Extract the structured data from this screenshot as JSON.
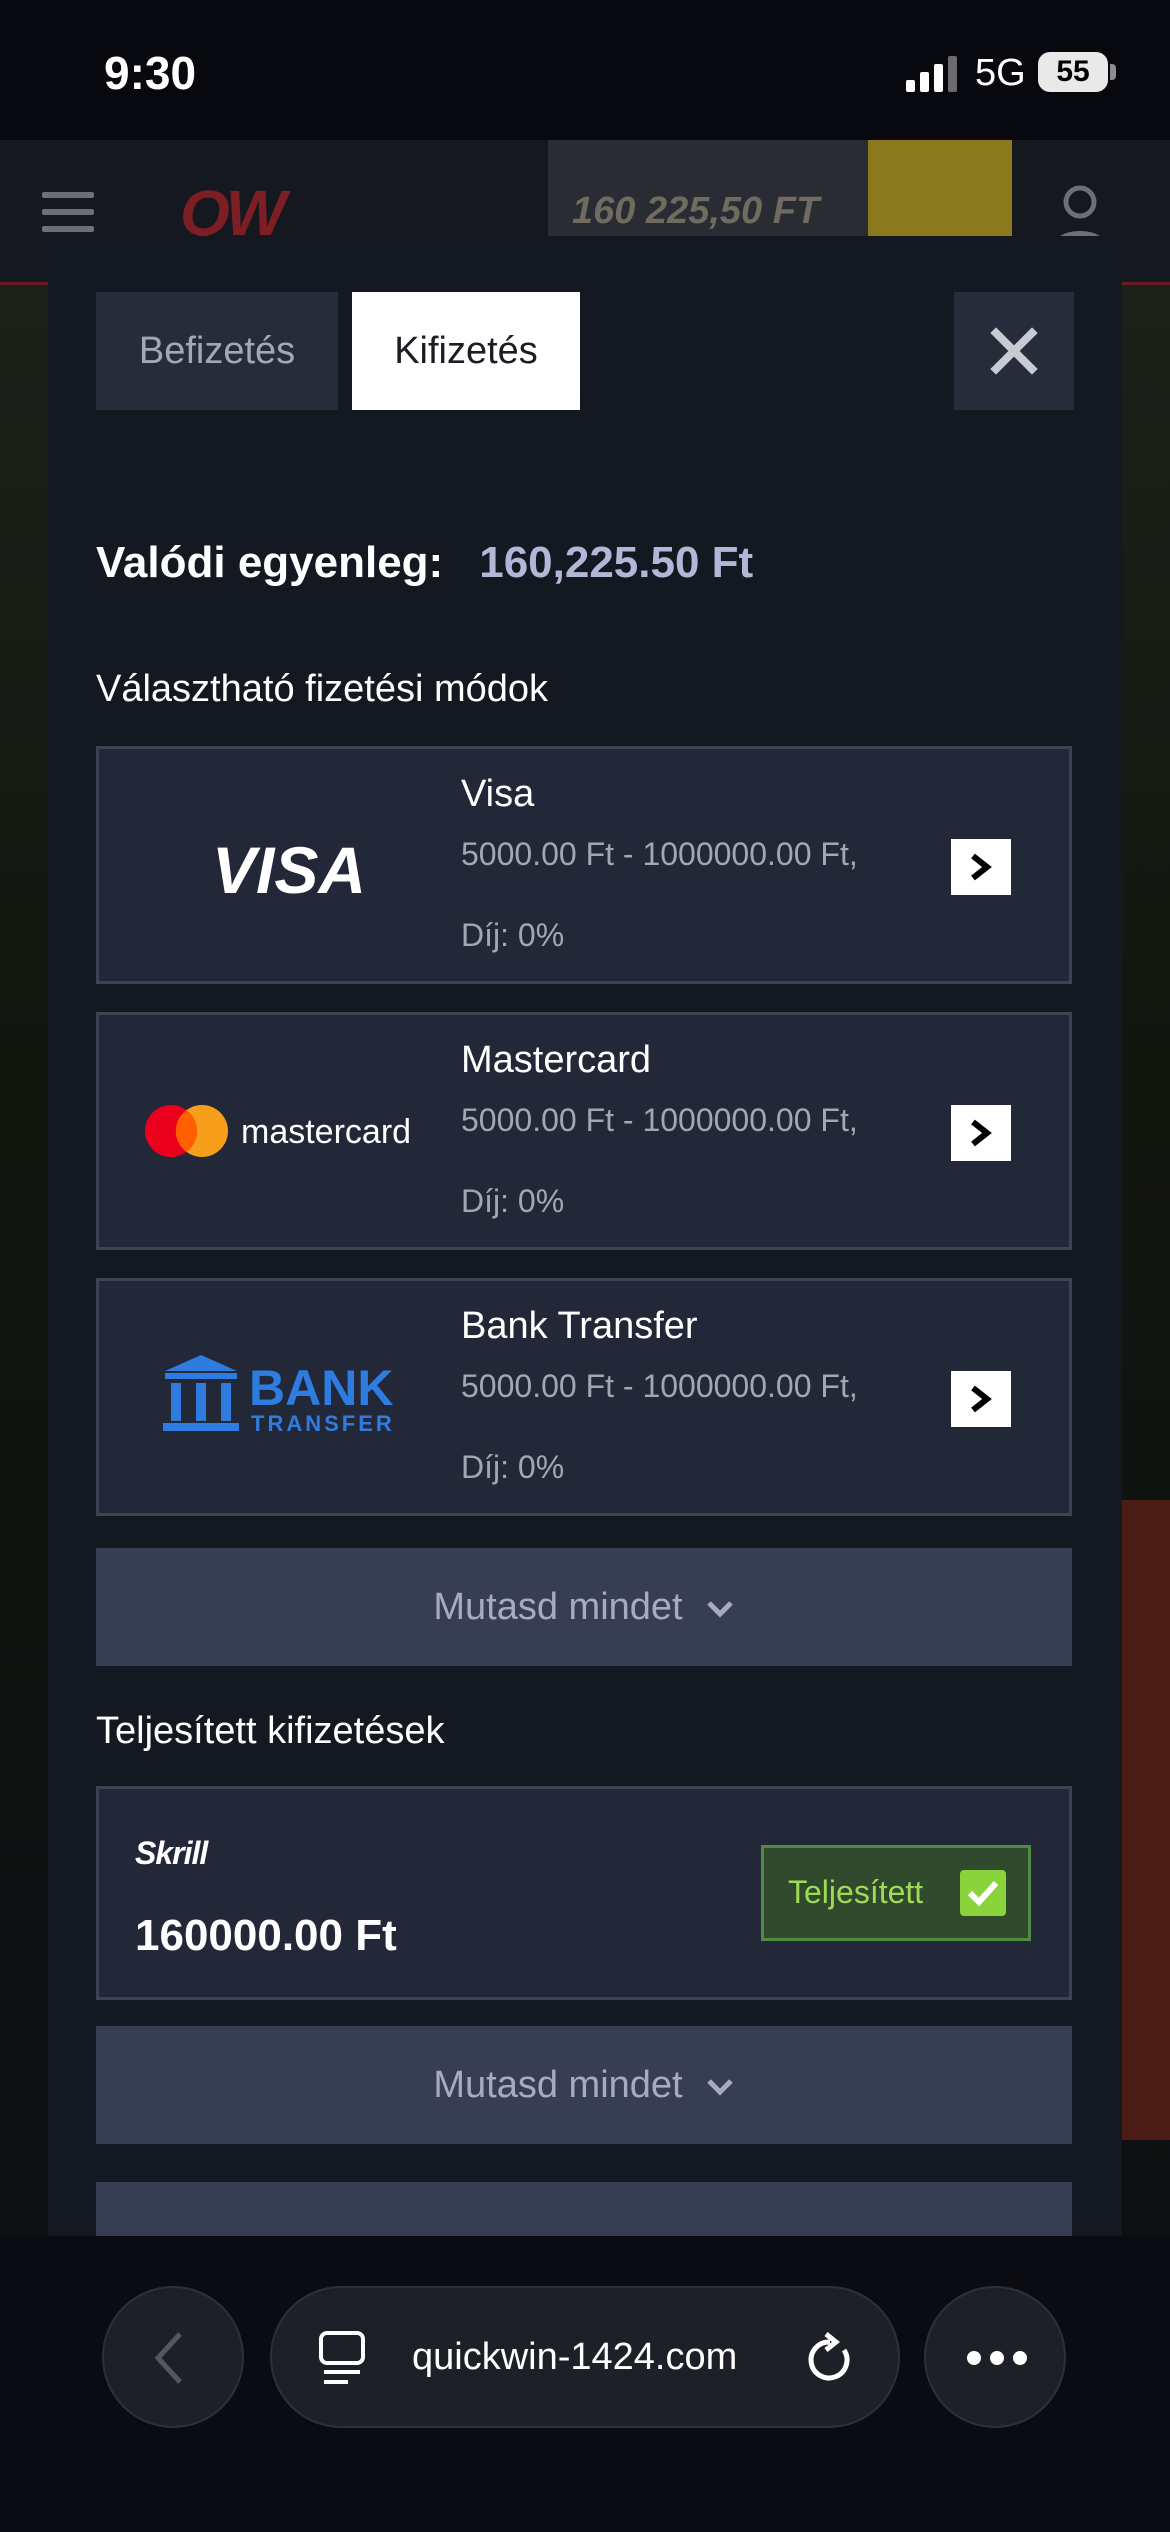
{
  "status_bar": {
    "time": "9:30",
    "network": "5G",
    "battery": "55"
  },
  "site": {
    "logo": "QW",
    "balance": "160 225,50 FT"
  },
  "modal": {
    "tabs": [
      {
        "label": "Befizetés",
        "active": false
      },
      {
        "label": "Kifizetés",
        "active": true
      }
    ],
    "balance_label": "Valódi egyenleg:",
    "balance_value": "160,225.50 Ft",
    "methods_title": "Választható fizetési módok",
    "methods": [
      {
        "logo": "VISA",
        "name": "Visa",
        "limits": "5000.00 Ft - 1000000.00 Ft,",
        "fee": "Díj: 0%"
      },
      {
        "logo": "mastercard",
        "name": "Mastercard",
        "limits": "5000.00 Ft - 1000000.00 Ft,",
        "fee": "Díj: 0%"
      },
      {
        "logo_line1": "BANK",
        "logo_line2": "TRANSFER",
        "name": "Bank Transfer",
        "limits": "5000.00 Ft - 1000000.00 Ft,",
        "fee": "Díj: 0%"
      }
    ],
    "show_all_label": "Mutasd mindet",
    "completed_title": "Teljesített kifizetések",
    "completed": [
      {
        "provider": "Skrill",
        "amount": "160000.00 Ft",
        "status": "Teljesített"
      }
    ]
  },
  "browser": {
    "url": "quickwin-1424.com"
  },
  "colors": {
    "accent_green": "#8bd33b",
    "card_bg": "#232838",
    "modal_bg": "#141821",
    "balance_text": "#b3b6d6"
  }
}
